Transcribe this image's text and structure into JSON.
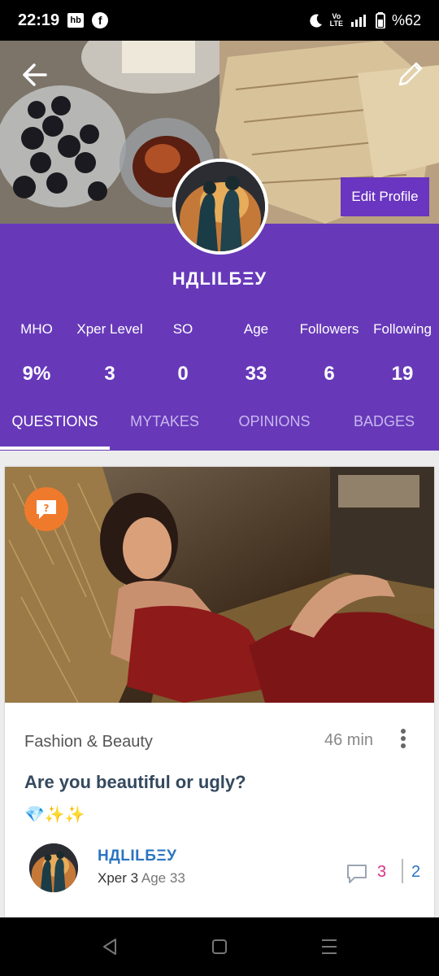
{
  "status_bar": {
    "time": "22:19",
    "battery": "%62",
    "icons": [
      "hb-icon",
      "facebook-icon",
      "moon-icon",
      "volte-icon",
      "signal-icon",
      "battery-icon"
    ]
  },
  "header": {
    "edit_profile_label": "Edit Profile"
  },
  "profile": {
    "username": "НДLILБΞУ"
  },
  "stats": [
    {
      "label": "MHO",
      "value": "9%"
    },
    {
      "label": "Xper Level",
      "value": "3"
    },
    {
      "label": "SO",
      "value": "0"
    },
    {
      "label": "Age",
      "value": "33"
    },
    {
      "label": "Followers",
      "value": "6"
    },
    {
      "label": "Following",
      "value": "19"
    }
  ],
  "tabs": [
    {
      "label": "QUESTIONS",
      "active": true
    },
    {
      "label": "MYTAKES",
      "active": false
    },
    {
      "label": "OPINIONS",
      "active": false
    },
    {
      "label": "BADGES",
      "active": false
    }
  ],
  "post": {
    "category": "Fashion & Beauty",
    "time_ago": "46 min",
    "title": "Are you beautiful or ugly?",
    "emojis": "💎✨✨",
    "author": {
      "name": "НДLILБΞУ",
      "xper": "Xper 3",
      "age": "Age 33"
    },
    "comments_count": "3",
    "opinions_count": "2"
  },
  "colors": {
    "brand_purple": "#6739b9",
    "badge_orange": "#f07a2b",
    "link_blue": "#2b74c2",
    "comment_pink": "#d63384"
  }
}
